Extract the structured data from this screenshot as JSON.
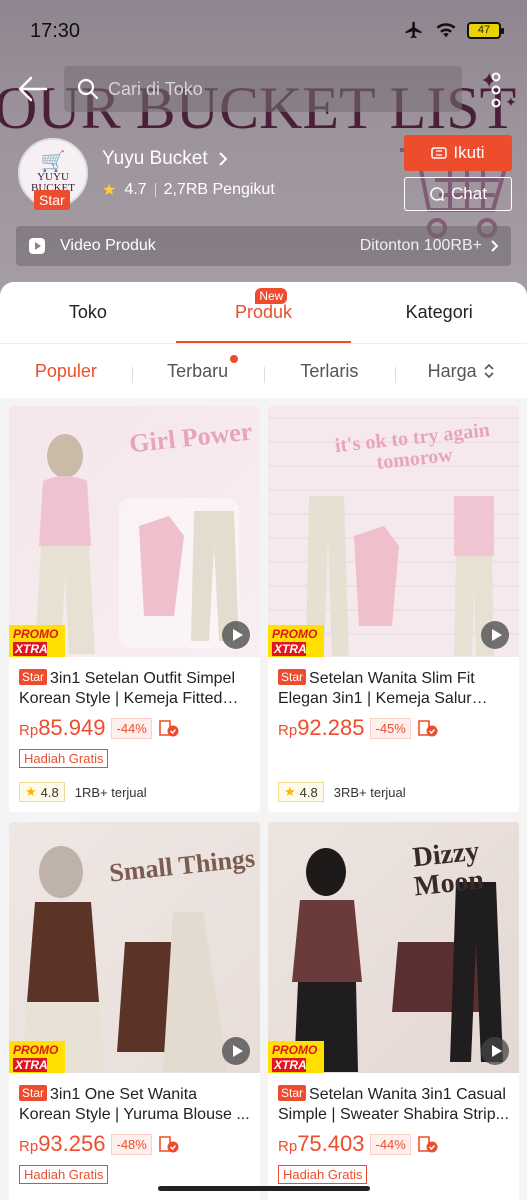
{
  "status_bar": {
    "time": "17:30",
    "battery": "47"
  },
  "header": {
    "banner_text": "OUR BUCKET LIST",
    "search_placeholder": "Cari di Toko",
    "logo_text": "YUYU BUCKET",
    "logo_badge": "Star",
    "shop_name": "Yuyu Bucket",
    "rating": "4.7",
    "followers": "2,7RB Pengikut",
    "follow_label": "Ikuti",
    "chat_label": "Chat",
    "video_label": "Video Produk",
    "video_views": "Ditonton 100RB+"
  },
  "tabs": [
    {
      "label": "Toko",
      "active": false
    },
    {
      "label": "Produk",
      "active": true,
      "badge": "New"
    },
    {
      "label": "Kategori",
      "active": false
    }
  ],
  "sort": [
    {
      "label": "Populer",
      "active": true
    },
    {
      "label": "Terbaru",
      "dot": true
    },
    {
      "label": "Terlaris"
    },
    {
      "label": "Harga"
    }
  ],
  "products": [
    {
      "thumb_title": "Girl Power",
      "badge": "Star",
      "title": "3in1 Setelan Outfit Simpel Korean Style | Kemeja Fitted S...",
      "currency": "Rp",
      "price": "85.949",
      "discount": "-44%",
      "gift": "Hadiah Gratis",
      "rating": "4.8",
      "sold": "1RB+ terjual"
    },
    {
      "thumb_title": "it's ok to try again tomorow",
      "badge": "Star",
      "title": "Setelan Wanita Slim Fit Elegan 3in1 | Kemeja Salur Fitt...",
      "currency": "Rp",
      "price": "92.285",
      "discount": "-45%",
      "gift": "",
      "rating": "4.8",
      "sold": "3RB+ terjual"
    },
    {
      "thumb_title": "Small Things",
      "badge": "Star",
      "title": "3in1 One Set Wanita Korean Style | Yuruma Blouse ...",
      "currency": "Rp",
      "price": "93.256",
      "discount": "-48%",
      "gift": "Hadiah Gratis",
      "rating": "",
      "sold": ""
    },
    {
      "thumb_title": "Dizzy Moon",
      "badge": "Star",
      "title": "Setelan Wanita 3in1 Casual Simple | Sweater Shabira Strip...",
      "currency": "Rp",
      "price": "75.403",
      "discount": "-44%",
      "gift": "Hadiah Gratis",
      "rating": "",
      "sold": ""
    }
  ],
  "promo": {
    "line1": "PROMO",
    "line2": "XTRA"
  },
  "colors": {
    "accent": "#ee4d2d",
    "promo_yellow": "#ffe000"
  }
}
